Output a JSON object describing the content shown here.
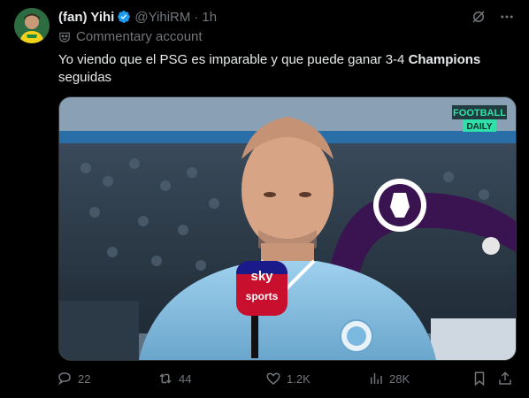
{
  "tweet": {
    "display_name": "(fan) Yihi",
    "handle": "@YihiRM",
    "dot": "·",
    "time": "1h",
    "label": "Commentary account",
    "text_before": "Yo viendo que el PSG es imparable y que puede ganar 3-4 ",
    "text_bold": "Champions",
    "text_after": " seguidas"
  },
  "media": {
    "brand_top": "FOOTBALL",
    "brand_bottom": "DAILY",
    "sky": "sky",
    "sports": "sports"
  },
  "actions": {
    "replies": "22",
    "reposts": "44",
    "likes": "1.2K",
    "views": "28K"
  },
  "colors": {
    "background": "#000000",
    "text": "#e7e9ea",
    "muted": "#71767b",
    "verified": "#1d9bf0"
  }
}
